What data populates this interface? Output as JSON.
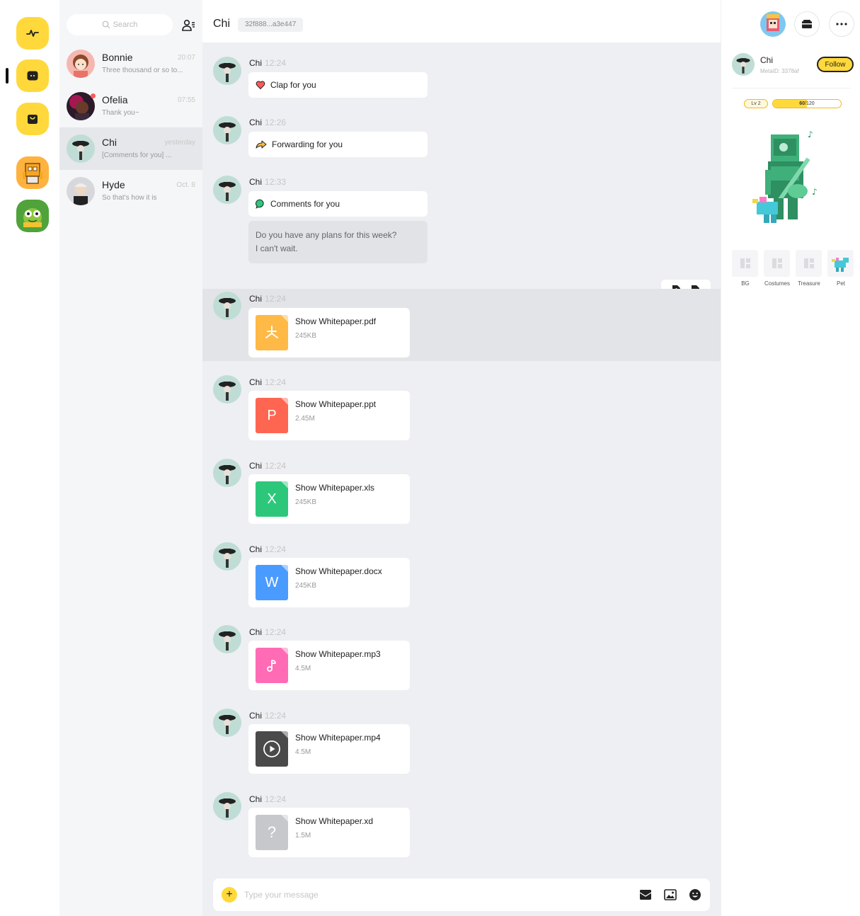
{
  "colors": {
    "accent": "#FFD93B",
    "chat_bg": "#EEEFF2",
    "list_bg": "#F5F6F7"
  },
  "conversations": {
    "search_placeholder": "Search",
    "items": [
      {
        "name": "Bonnie",
        "preview": "Three thousand or so to...",
        "time": "20:07"
      },
      {
        "name": "Ofelia",
        "preview": "Thank you~",
        "time": "07:55"
      },
      {
        "name": "Chi",
        "preview": "[Comments for you] ...",
        "time": "yesterday"
      },
      {
        "name": "Hyde",
        "preview": "So that's how it is",
        "time": "Oct. 8"
      }
    ]
  },
  "chat": {
    "title": "Chi",
    "address": "32f888...a3e447",
    "messages": [
      {
        "sender": "Chi",
        "time": "12:24",
        "text": "Clap for you",
        "icon": "heart-icon"
      },
      {
        "sender": "Chi",
        "time": "12:26",
        "text": "Forwarding for you",
        "icon": "forward-arrow-icon"
      },
      {
        "sender": "Chi",
        "time": "12:33",
        "text": "Comments for you",
        "icon": "comment-bubble-icon",
        "extra_line1": "Do you have any plans for this week?",
        "extra_line2": "I can't wait."
      }
    ],
    "files": [
      {
        "sender": "Chi",
        "time": "12:24",
        "name": "Show Whitepaper.pdf",
        "size": "245KB",
        "kind": "pdf",
        "color": "#FFB946"
      },
      {
        "sender": "Chi",
        "time": "12:24",
        "name": "Show Whitepaper.ppt",
        "size": "2.45M",
        "kind": "ppt",
        "letter": "P",
        "color": "#FF6652"
      },
      {
        "sender": "Chi",
        "time": "12:24",
        "name": "Show Whitepaper.xls",
        "size": "245KB",
        "kind": "xls",
        "letter": "X",
        "color": "#2DC77C"
      },
      {
        "sender": "Chi",
        "time": "12:24",
        "name": "Show Whitepaper.docx",
        "size": "245KB",
        "kind": "docx",
        "letter": "W",
        "color": "#4A9BFF"
      },
      {
        "sender": "Chi",
        "time": "12:24",
        "name": "Show Whitepaper.mp3",
        "size": "4.5M",
        "kind": "mp3",
        "color": "#FF6BB5"
      },
      {
        "sender": "Chi",
        "time": "12:24",
        "name": "Show Whitepaper.mp4",
        "size": "4.5M",
        "kind": "mp4",
        "color": "#4A4A4A"
      },
      {
        "sender": "Chi",
        "time": "12:24",
        "name": "Show Whitepaper.xd",
        "size": "1.5M",
        "kind": "xd",
        "letter": "?",
        "color": "#C7C8CC"
      }
    ],
    "input_placeholder": "Type your message"
  },
  "profile": {
    "name": "Chi",
    "meta_id": "MetaID: 3378af",
    "follow_label": "Follow",
    "level": "Lv 2",
    "xp_current": "60",
    "xp_total": "/120",
    "xp_fraction": 0.5,
    "items": [
      "BG",
      "Costumes",
      "Treasure",
      "Pet"
    ]
  }
}
